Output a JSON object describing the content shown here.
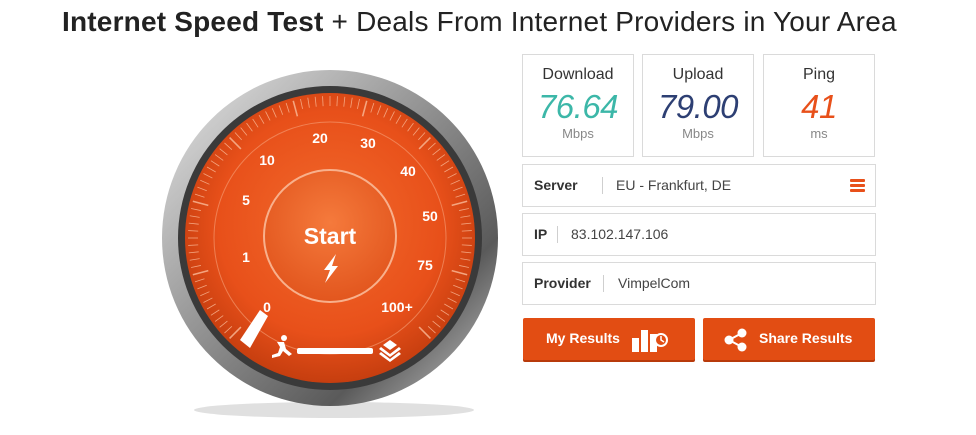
{
  "header": {
    "title_bold": "Internet Speed Test",
    "title_rest": " + Deals From Internet Providers in Your Area"
  },
  "gauge": {
    "start_label": "Start",
    "scale": [
      "0",
      "1",
      "5",
      "10",
      "20",
      "30",
      "40",
      "50",
      "75",
      "100+"
    ],
    "colors": {
      "face": "#e8501a",
      "bezel": "#7d7d7d"
    }
  },
  "stats": {
    "download": {
      "label": "Download",
      "value": "76.64",
      "unit": "Mbps",
      "color": "#3cb7a8"
    },
    "upload": {
      "label": "Upload",
      "value": "79.00",
      "unit": "Mbps",
      "color": "#2d3f73"
    },
    "ping": {
      "label": "Ping",
      "value": "41",
      "unit": "ms",
      "color": "#e8501a"
    }
  },
  "info": {
    "server": {
      "label": "Server",
      "value": "EU - Frankfurt, DE",
      "icon": "menu-icon"
    },
    "ip": {
      "label": "IP",
      "value": "83.102.147.106"
    },
    "provider": {
      "label": "Provider",
      "value": "VimpelCom"
    }
  },
  "buttons": {
    "my_results": {
      "label": "My Results",
      "icon": "results-chart-icon"
    },
    "share_results": {
      "label": "Share Results",
      "icon": "share-icon"
    }
  }
}
